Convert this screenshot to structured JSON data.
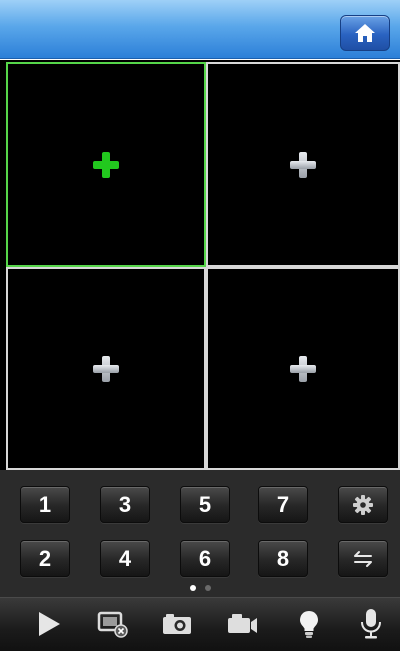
{
  "top_bar": {
    "home_icon": "home-icon"
  },
  "channels": [
    {
      "id": 1,
      "state": "selected",
      "icon": "add-icon"
    },
    {
      "id": 2,
      "state": "empty",
      "icon": "add-icon"
    },
    {
      "id": 3,
      "state": "empty",
      "icon": "add-icon"
    },
    {
      "id": 4,
      "state": "empty",
      "icon": "add-icon"
    }
  ],
  "keypad": {
    "row1": [
      "1",
      "3",
      "5",
      "7"
    ],
    "row2": [
      "2",
      "4",
      "6",
      "8"
    ],
    "extra_icons": [
      "gear-icon",
      "swap-icon"
    ]
  },
  "pager": {
    "pages": 2,
    "current": 1
  },
  "toolbar": {
    "icons": [
      "play-icon",
      "close-stream-icon",
      "snapshot-icon",
      "record-icon",
      "light-icon",
      "microphone-icon"
    ]
  },
  "colors": {
    "top_bar": "#5aa7ea",
    "selected_border": "#56d64a",
    "selected_plus": "#22c81e",
    "plus": "#c9ccd1",
    "panel": "#2b2b2b"
  }
}
